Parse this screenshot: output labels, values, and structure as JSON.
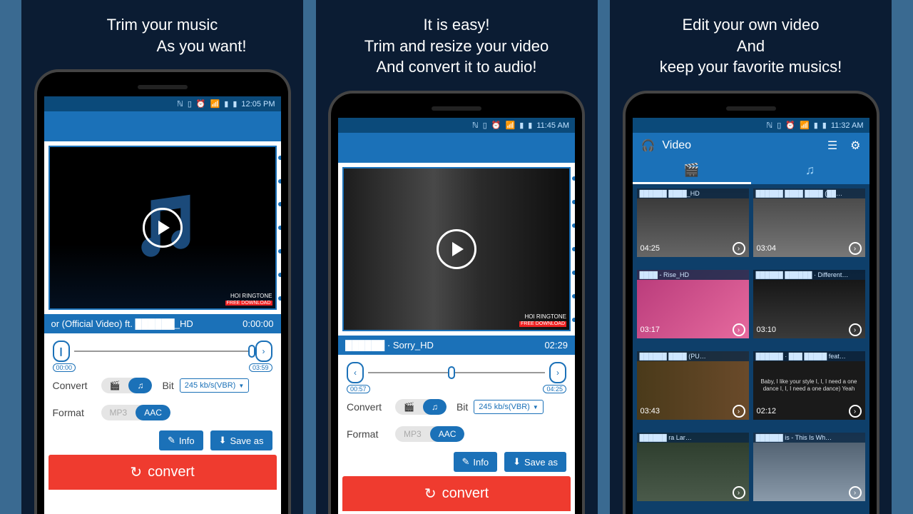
{
  "panel1": {
    "headline1": "Trim your music",
    "headline2": "As you want!",
    "status_time": "12:05 PM",
    "ringtone_label": "HOI RINGTONE",
    "ringtone_free": "FREE DOWNLOAD",
    "track_title": "or (Official Video) ft. ██████_HD",
    "track_time": "0:00:00",
    "trim_start": "00:00",
    "trim_end": "03:59",
    "convert_label": "Convert",
    "bit_label": "Bit",
    "bit_value": "245 kb/s(VBR)",
    "format_label": "Format",
    "format_mp3": "MP3",
    "format_aac": "AAC",
    "info_btn": "Info",
    "save_btn": "Save as",
    "convert_btn": "convert"
  },
  "panel2": {
    "headline1": "It is easy!",
    "headline2": "Trim and resize your video",
    "headline3": "And convert it to audio!",
    "status_time": "11:45 AM",
    "ringtone_label": "HOI RINGTONE",
    "ringtone_free": "FREE DOWNLOAD",
    "track_title": "██████ · Sorry_HD",
    "track_time": "02:29",
    "trim_start": "00:57",
    "trim_end": "04:25",
    "convert_label": "Convert",
    "bit_label": "Bit",
    "bit_value": "245 kb/s(VBR)",
    "format_label": "Format",
    "format_mp3": "MP3",
    "format_aac": "AAC",
    "info_btn": "Info",
    "save_btn": "Save as",
    "convert_btn": "convert"
  },
  "panel3": {
    "headline1": "Edit your own video",
    "headline2": "And",
    "headline3": "keep your favorite musics!",
    "status_time": "11:32 AM",
    "header_title": "Video",
    "videos": [
      {
        "caption": "██████ ████_HD",
        "duration": "04:25",
        "img": "a"
      },
      {
        "caption": "██████ ████ ████ (██…",
        "duration": "03:04",
        "img": "b"
      },
      {
        "caption": "████ - Rise_HD",
        "duration": "03:17",
        "img": "c"
      },
      {
        "caption": "██████ ██████ · Different…",
        "duration": "03:10",
        "img": "d"
      },
      {
        "caption": "██████ ████ (PU…",
        "duration": "03:43",
        "img": "e"
      },
      {
        "caption": "██████ · ███ █████ feat…",
        "duration": "02:12",
        "img": "f",
        "lyrics": "Baby, I like your style\nI, I, I need a one dance\nI, I, I need a one dance)\nYeah"
      },
      {
        "caption": "██████ ra Lar…",
        "duration": "",
        "img": "g"
      },
      {
        "caption": "██████ is - This Is Wh…",
        "duration": "",
        "img": "h"
      }
    ]
  }
}
